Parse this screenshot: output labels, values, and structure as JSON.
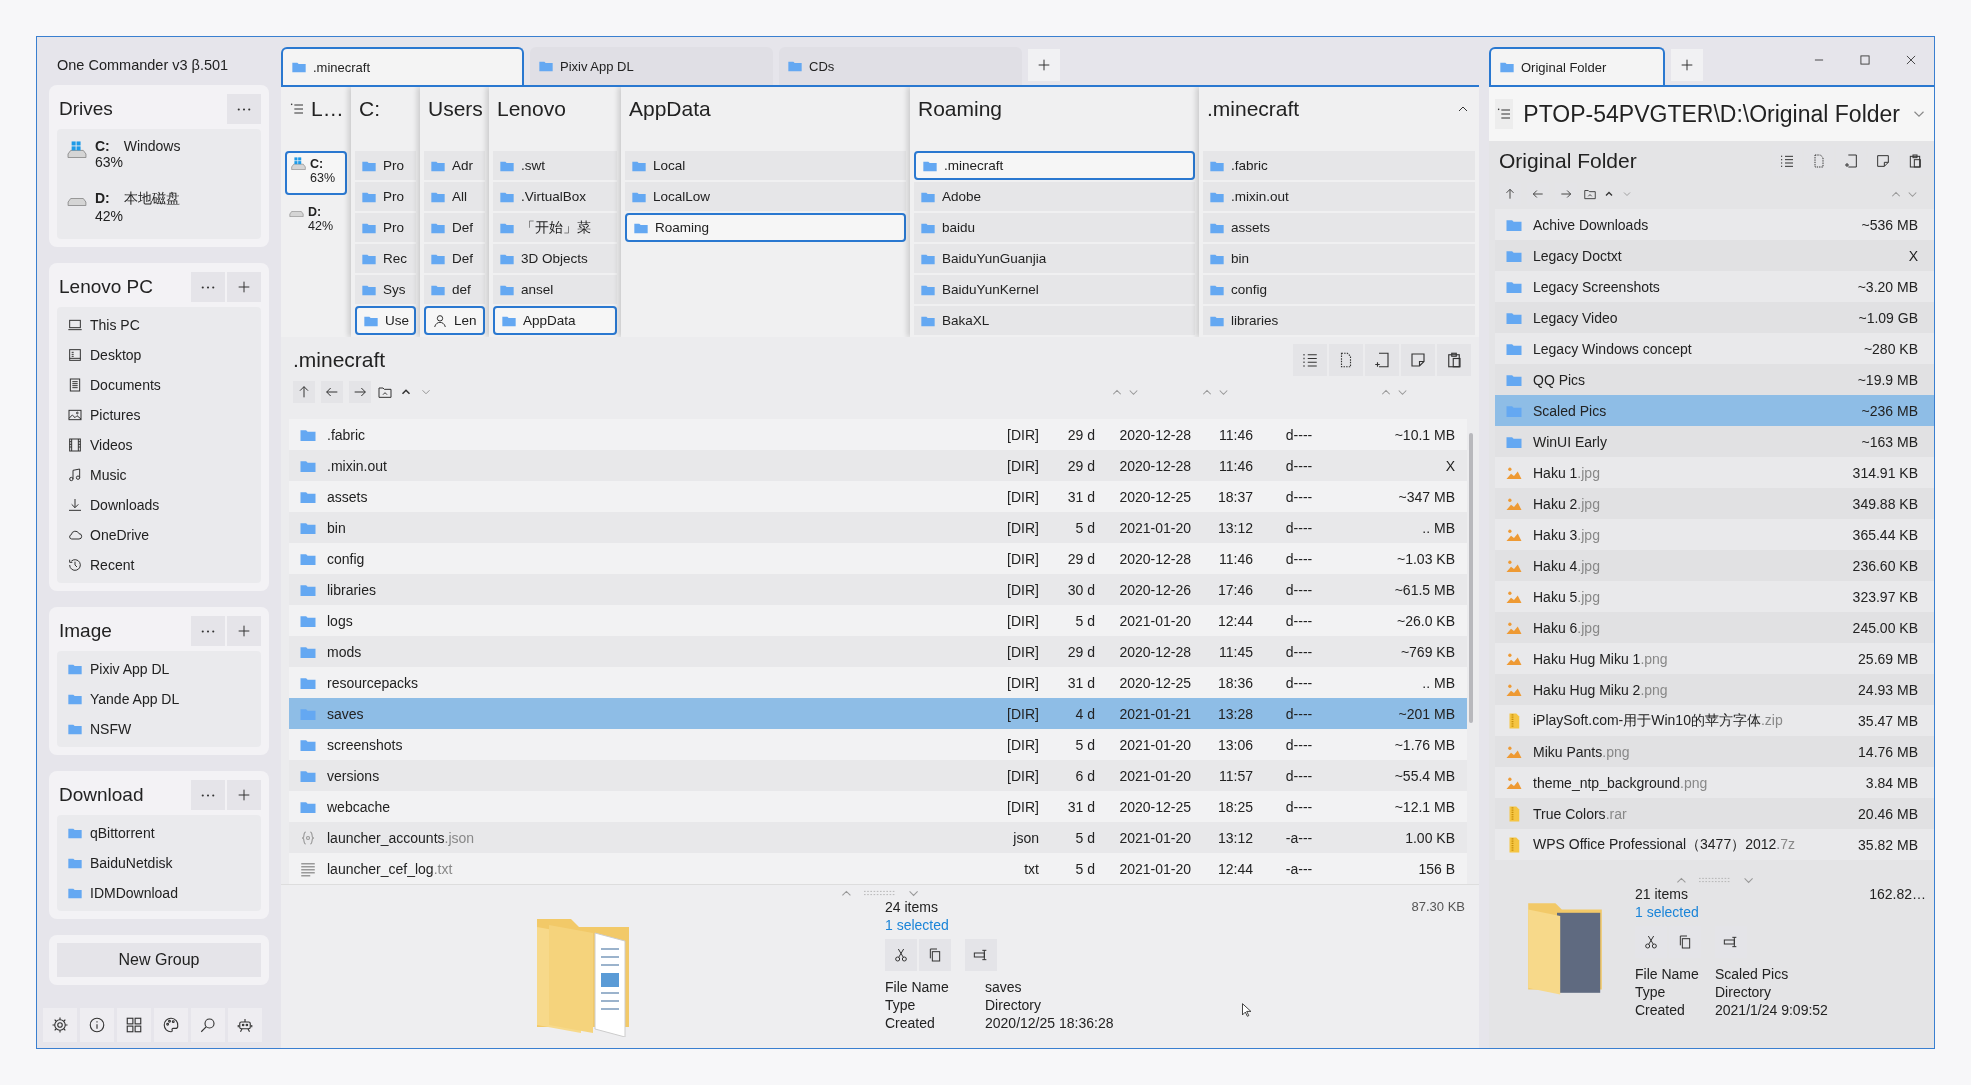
{
  "app_title": "One Commander v3 β.501",
  "sidebar": {
    "drives": {
      "title": "Drives",
      "items": [
        {
          "letter": "C:",
          "label": "Windows",
          "usage": "63%",
          "system": true
        },
        {
          "letter": "D:",
          "label": "本地磁盘",
          "usage": "42%",
          "system": false
        }
      ]
    },
    "groups": [
      {
        "title": "Lenovo PC",
        "items": [
          {
            "label": "This PC",
            "kind": "pc"
          },
          {
            "label": "Desktop",
            "kind": "desktop"
          },
          {
            "label": "Documents",
            "kind": "documents"
          },
          {
            "label": "Pictures",
            "kind": "pictures"
          },
          {
            "label": "Videos",
            "kind": "videos"
          },
          {
            "label": "Music",
            "kind": "music"
          },
          {
            "label": "Downloads",
            "kind": "downloads"
          },
          {
            "label": "OneDrive",
            "kind": "cloud"
          },
          {
            "label": "Recent",
            "kind": "recent"
          }
        ]
      },
      {
        "title": "Image",
        "items": [
          {
            "label": "Pixiv App DL",
            "kind": "folder"
          },
          {
            "label": "Yande App DL",
            "kind": "folder"
          },
          {
            "label": "NSFW",
            "kind": "folder"
          }
        ]
      },
      {
        "title": "Download",
        "items": [
          {
            "label": "qBittorrent",
            "kind": "folder"
          },
          {
            "label": "BaiduNetdisk",
            "kind": "folder"
          },
          {
            "label": "IDMDownload",
            "kind": "folder"
          }
        ]
      }
    ],
    "new_group": "New Group"
  },
  "left_pane": {
    "tabs": [
      {
        "label": ".minecraft",
        "selected": true
      },
      {
        "label": "Pixiv App DL",
        "selected": false
      },
      {
        "label": "CDs",
        "selected": false
      }
    ],
    "columns": [
      {
        "title": "L…",
        "kind": "drives",
        "items": [
          {
            "letter": "C:",
            "usage": "63%",
            "system": true,
            "selected": true
          },
          {
            "letter": "D:",
            "usage": "42%",
            "system": false,
            "selected": false
          }
        ]
      },
      {
        "title": "C:",
        "kind": "folders",
        "items": [
          {
            "label": "Pro",
            "selected": false
          },
          {
            "label": "Pro",
            "selected": false
          },
          {
            "label": "Pro",
            "selected": false
          },
          {
            "label": "Rec",
            "selected": false
          },
          {
            "label": "Sys",
            "selected": false
          },
          {
            "label": "Use",
            "selected": true
          }
        ]
      },
      {
        "title": "Users",
        "kind": "folders",
        "items": [
          {
            "label": "Adr",
            "kind": "folder",
            "selected": false
          },
          {
            "label": "All",
            "kind": "folder",
            "selected": false
          },
          {
            "label": "Def",
            "kind": "folder",
            "selected": false
          },
          {
            "label": "Def",
            "kind": "folder",
            "selected": false
          },
          {
            "label": "def",
            "kind": "folder",
            "selected": false
          },
          {
            "label": "Len",
            "kind": "user",
            "selected": true
          }
        ]
      },
      {
        "title": "Lenovo",
        "kind": "folders",
        "items": [
          {
            "label": ".swt",
            "selected": false
          },
          {
            "label": ".VirtualBox",
            "selected": false
          },
          {
            "label": "「开始」菜",
            "selected": false
          },
          {
            "label": "3D Objects",
            "selected": false
          },
          {
            "label": "ansel",
            "selected": false
          },
          {
            "label": "AppData",
            "selected": true
          }
        ]
      },
      {
        "title": "AppData",
        "kind": "folders",
        "items": [
          {
            "label": "Local",
            "selected": false
          },
          {
            "label": "LocalLow",
            "selected": false
          },
          {
            "label": "Roaming",
            "selected": true
          }
        ]
      },
      {
        "title": "Roaming",
        "kind": "folders",
        "items": [
          {
            "label": ".minecraft",
            "selected": true
          },
          {
            "label": "Adobe",
            "selected": false
          },
          {
            "label": "baidu",
            "selected": false
          },
          {
            "label": "BaiduYunGuanjia",
            "selected": false
          },
          {
            "label": "BaiduYunKernel",
            "selected": false
          },
          {
            "label": "BakaXL",
            "selected": false
          }
        ]
      },
      {
        "title": ".minecraft",
        "kind": "folders",
        "items": [
          {
            "label": ".fabric",
            "selected": false
          },
          {
            "label": ".mixin.out",
            "selected": false
          },
          {
            "label": "assets",
            "selected": false
          },
          {
            "label": "bin",
            "selected": false
          },
          {
            "label": "config",
            "selected": false
          },
          {
            "label": "libraries",
            "selected": false
          }
        ]
      }
    ],
    "list": {
      "title": ".minecraft",
      "rows": [
        {
          "kind": "folder",
          "name": ".fabric",
          "type": "[DIR]",
          "age": "29 d",
          "date": "2020-12-28",
          "time": "11:46",
          "attr": "d----",
          "size": "~10.1 MB",
          "selected": false
        },
        {
          "kind": "folder",
          "name": ".mixin.out",
          "type": "[DIR]",
          "age": "29 d",
          "date": "2020-12-28",
          "time": "11:46",
          "attr": "d----",
          "size": "X",
          "selected": false
        },
        {
          "kind": "folder",
          "name": "assets",
          "type": "[DIR]",
          "age": "31 d",
          "date": "2020-12-25",
          "time": "18:37",
          "attr": "d----",
          "size": "~347 MB",
          "selected": false
        },
        {
          "kind": "folder",
          "name": "bin",
          "type": "[DIR]",
          "age": "5 d",
          "date": "2021-01-20",
          "time": "13:12",
          "attr": "d----",
          "size": ".. MB",
          "selected": false
        },
        {
          "kind": "folder",
          "name": "config",
          "type": "[DIR]",
          "age": "29 d",
          "date": "2020-12-28",
          "time": "11:46",
          "attr": "d----",
          "size": "~1.03 KB",
          "selected": false
        },
        {
          "kind": "folder",
          "name": "libraries",
          "type": "[DIR]",
          "age": "30 d",
          "date": "2020-12-26",
          "time": "17:46",
          "attr": "d----",
          "size": "~61.5 MB",
          "selected": false
        },
        {
          "kind": "folder",
          "name": "logs",
          "type": "[DIR]",
          "age": "5 d",
          "date": "2021-01-20",
          "time": "12:44",
          "attr": "d----",
          "size": "~26.0 KB",
          "selected": false
        },
        {
          "kind": "folder",
          "name": "mods",
          "type": "[DIR]",
          "age": "29 d",
          "date": "2020-12-28",
          "time": "11:45",
          "attr": "d----",
          "size": "~769 KB",
          "selected": false
        },
        {
          "kind": "folder",
          "name": "resourcepacks",
          "type": "[DIR]",
          "age": "31 d",
          "date": "2020-12-25",
          "time": "18:36",
          "attr": "d----",
          "size": ".. MB",
          "selected": false
        },
        {
          "kind": "folder",
          "name": "saves",
          "type": "[DIR]",
          "age": "4 d",
          "date": "2021-01-21",
          "time": "13:28",
          "attr": "d----",
          "size": "~201 MB",
          "selected": true
        },
        {
          "kind": "folder",
          "name": "screenshots",
          "type": "[DIR]",
          "age": "5 d",
          "date": "2021-01-20",
          "time": "13:06",
          "attr": "d----",
          "size": "~1.76 MB",
          "selected": false
        },
        {
          "kind": "folder",
          "name": "versions",
          "type": "[DIR]",
          "age": "6 d",
          "date": "2021-01-20",
          "time": "11:57",
          "attr": "d----",
          "size": "~55.4 MB",
          "selected": false
        },
        {
          "kind": "folder",
          "name": "webcache",
          "type": "[DIR]",
          "age": "31 d",
          "date": "2020-12-25",
          "time": "18:25",
          "attr": "d----",
          "size": "~12.1 MB",
          "selected": false
        },
        {
          "kind": "code",
          "name": "launcher_accounts",
          "ext": ".json",
          "type": "json",
          "age": "5 d",
          "date": "2021-01-20",
          "time": "13:12",
          "attr": "-a---",
          "size": "1.00 KB",
          "selected": false
        },
        {
          "kind": "text",
          "name": "launcher_cef_log",
          "ext": ".txt",
          "type": "txt",
          "age": "5 d",
          "date": "2021-01-20",
          "time": "12:44",
          "attr": "-a---",
          "size": "156 B",
          "selected": false
        }
      ]
    },
    "info": {
      "preview": {
        "kind": "document"
      },
      "count": "24 items",
      "selection": "1 selected",
      "total": "87.30 KB",
      "props": [
        {
          "label": "File Name",
          "value": "saves"
        },
        {
          "label": "Type",
          "value": "Directory"
        },
        {
          "label": "Created",
          "value": "2020/12/25 18:36:28"
        }
      ]
    }
  },
  "right_pane": {
    "tabs": [
      {
        "label": "Original Folder",
        "selected": true
      }
    ],
    "path": "PTOP-54PVGTER\\D:\\Original Folder",
    "list": {
      "title": "Original Folder",
      "rows": [
        {
          "kind": "folder",
          "name": "Achive Downloads",
          "size": "~536 MB",
          "selected": false
        },
        {
          "kind": "folder",
          "name": "Legacy Doctxt",
          "size": "X",
          "selected": false
        },
        {
          "kind": "folder",
          "name": "Legacy Screenshots",
          "size": "~3.20 MB",
          "selected": false
        },
        {
          "kind": "folder",
          "name": "Legacy Video",
          "size": "~1.09 GB",
          "selected": false
        },
        {
          "kind": "folder",
          "name": "Legacy Windows concept",
          "size": "~280 KB",
          "selected": false
        },
        {
          "kind": "folder",
          "name": "QQ Pics",
          "size": "~19.9 MB",
          "selected": false
        },
        {
          "kind": "folder",
          "name": "Scaled Pics",
          "size": "~236 MB",
          "selected": true
        },
        {
          "kind": "folder",
          "name": "WinUI Early",
          "size": "~163 MB",
          "selected": false
        },
        {
          "kind": "image",
          "name": "Haku 1",
          "ext": ".jpg",
          "size": "314.91 KB",
          "selected": false
        },
        {
          "kind": "image",
          "name": "Haku 2",
          "ext": ".jpg",
          "size": "349.88 KB",
          "selected": false
        },
        {
          "kind": "image",
          "name": "Haku 3",
          "ext": ".jpg",
          "size": "365.44 KB",
          "selected": false
        },
        {
          "kind": "image",
          "name": "Haku 4",
          "ext": ".jpg",
          "size": "236.60 KB",
          "selected": false
        },
        {
          "kind": "image",
          "name": "Haku 5",
          "ext": ".jpg",
          "size": "323.97 KB",
          "selected": false
        },
        {
          "kind": "image",
          "name": "Haku 6",
          "ext": ".jpg",
          "size": "245.00 KB",
          "selected": false
        },
        {
          "kind": "image",
          "name": "Haku Hug Miku 1",
          "ext": ".png",
          "size": "25.69 MB",
          "selected": false
        },
        {
          "kind": "image",
          "name": "Haku Hug Miku 2",
          "ext": ".png",
          "size": "24.93 MB",
          "selected": false
        },
        {
          "kind": "archive",
          "name": "iPlaySoft.com-用于Win10的苹方字体",
          "ext": ".zip",
          "size": "35.47 MB",
          "selected": false
        },
        {
          "kind": "image",
          "name": "Miku Pants",
          "ext": ".png",
          "size": "14.76 MB",
          "selected": false
        },
        {
          "kind": "image",
          "name": "theme_ntp_background",
          "ext": ".png",
          "size": "3.84 MB",
          "selected": false
        },
        {
          "kind": "archive",
          "name": "True Colors",
          "ext": ".rar",
          "size": "20.46 MB",
          "selected": false
        },
        {
          "kind": "archive",
          "name": "WPS Office Professional（3477）2012",
          "ext": ".7z",
          "size": "35.82 MB",
          "selected": false
        }
      ]
    },
    "info": {
      "preview": {
        "kind": "photo"
      },
      "count": "21 items",
      "selection": "1 selected",
      "total": "162.82…",
      "props": [
        {
          "label": "File Name",
          "value": "Scaled Pics"
        },
        {
          "label": "Type",
          "value": "Directory"
        },
        {
          "label": "Created",
          "value": "2021/1/24 9:09:52"
        }
      ]
    }
  }
}
